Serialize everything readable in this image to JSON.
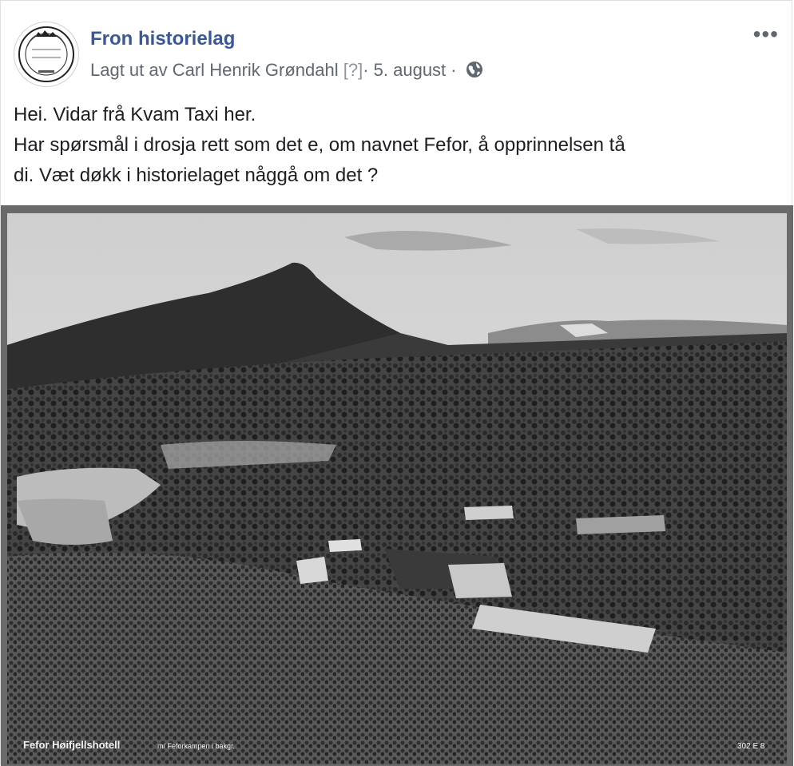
{
  "post": {
    "page_name": "Fron historielag",
    "posted_by_prefix": "Lagt ut av",
    "author": "Carl Henrik Grøndahl",
    "author_marker": "[?]",
    "separator": "·",
    "date": "5. august",
    "privacy_icon": "globe-icon",
    "more_icon": "more-options-icon",
    "more_glyph": "•••",
    "text_lines": [
      "Hei. Vidar frå Kvam Taxi her.",
      "Har spørsmål i drosja rett som det e, om navnet Fefor, å opprinnelsen tå",
      "di. Væt døkk i historielaget någgå om det ?"
    ]
  },
  "photo": {
    "caption": "Fefor Høifjellshotell",
    "caption_small": "m/ Feforkampen i bakgr.",
    "code": "302 E 8"
  },
  "colors": {
    "link": "#385898",
    "meta": "#606770",
    "text": "#1c1e21"
  }
}
